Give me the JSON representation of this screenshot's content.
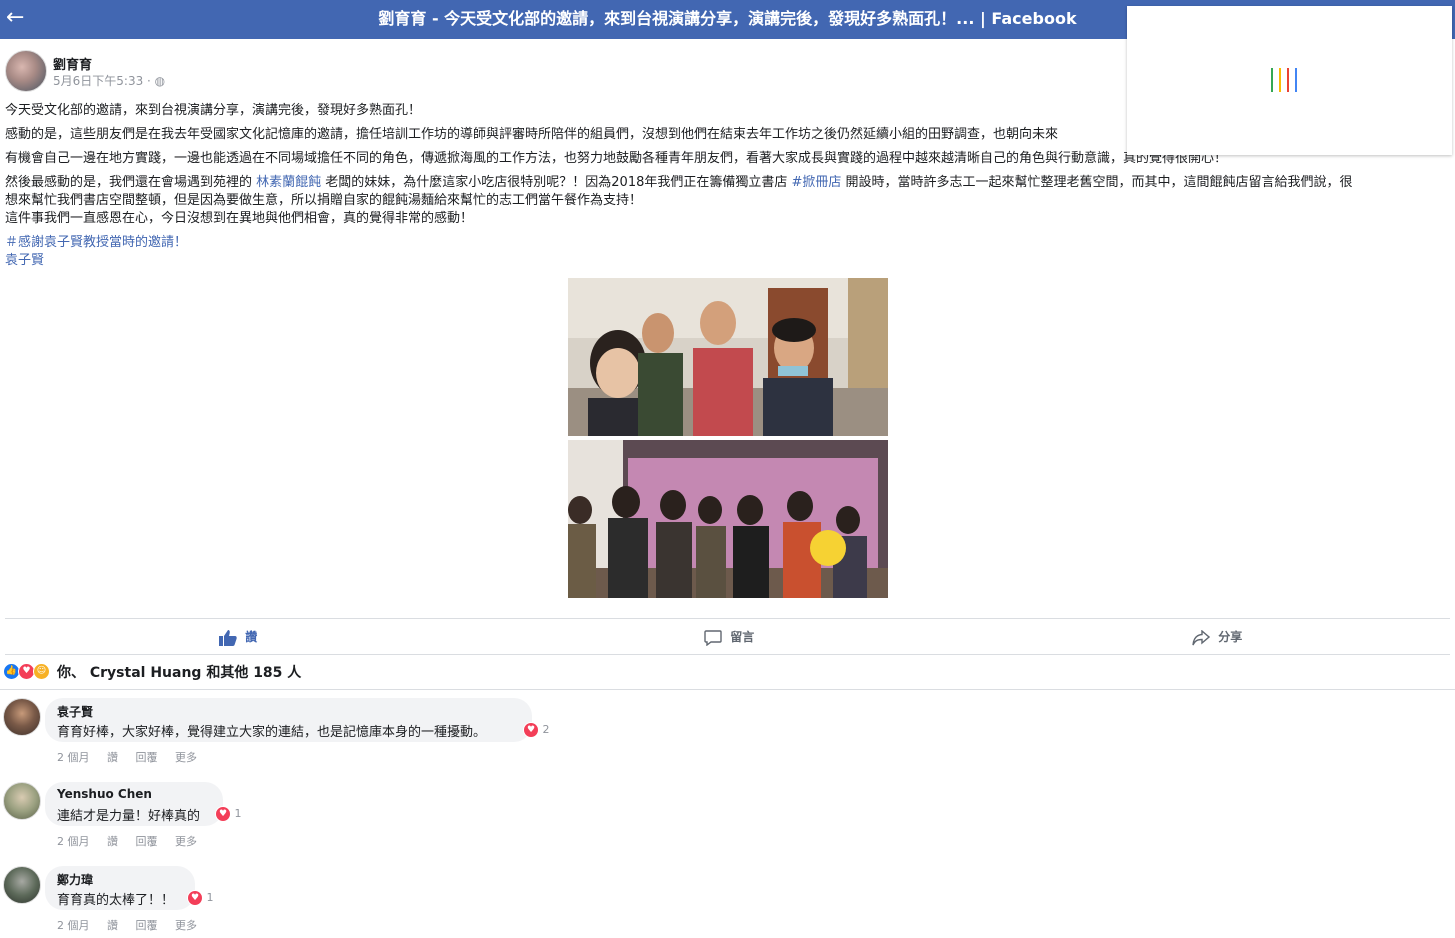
{
  "header": {
    "title": "劉育育 - 今天受文化部的邀請，來到台視演講分享，演講完後，發現好多熟面孔！... | Facebook",
    "back_icon": "←"
  },
  "loader": {
    "colors": [
      "#34a853",
      "#fbbc05",
      "#ea4335",
      "#4285f4"
    ]
  },
  "post": {
    "author": "劉育育",
    "meta": "5月6日下午5:33 · ◍",
    "lines": {
      "l1": "今天受文化部的邀請，來到台視演講分享，演講完後，發現好多熟面孔！",
      "l2": "感動的是，這些朋友們是在我去年受國家文化記憶庫的邀請，擔任培訓工作坊的導師與評審時所陪伴的組員們，沒想到他們在結束去年工作坊之後仍然延續小組的田野調查，也朝向未來",
      "l3": "有機會自己一邊在地方實踐，一邊也能透過在不同場域擔任不同的角色，傳遞掀海風的工作方法，也努力地鼓勵各種青年朋友們，看著大家成長與實踐的過程中越來越清晰自己的角色與行動意識，真的覺得很開心！",
      "l4a": "然後最感動的是，我們還在會場遇到苑裡的 ",
      "l4_link": "林素蘭餛飩",
      "l4b": " 老闆的妹妹，為什麼這家小吃店很特別呢？！因為2018年我們正在籌備獨立書店 ",
      "l4_tag": "#掀冊店",
      "l4c": " 開設時，當時許多志工一起來幫忙整理老舊空間，而其中，這間餛飩店留言給我們說，很",
      "l5": "想來幫忙我們書店空間整頓，但是因為要做生意，所以捐贈自家的餛飩湯麵給來幫忙的志工們當午餐作為支持！",
      "l6": "這件事我們一直感恩在心，今日沒想到在異地與他們相會，真的覺得非常的感動！",
      "hashtag": "＃感謝袁子賢教授當時的邀請！",
      "mention": "袁子賢"
    }
  },
  "actions": {
    "like": "讚",
    "comment": "留言",
    "share": "分享"
  },
  "reactions": {
    "text": "你、 Crystal Huang 和其他 185 人"
  },
  "comments": [
    {
      "name": "袁子賢",
      "text": "育育好棒，大家好棒，覺得建立大家的連結，也是記憶庫本身的一種擾動。",
      "reacts": "2",
      "time": "2 個月",
      "like": "讚",
      "reply": "回覆",
      "more": "更多"
    },
    {
      "name": "Yenshuo Chen",
      "text": "連結才是力量！好棒真的",
      "reacts": "1",
      "time": "2 個月",
      "like": "讚",
      "reply": "回覆",
      "more": "更多"
    },
    {
      "name": "鄭力瑋",
      "text": "育育真的太棒了！！",
      "reacts": "1",
      "time": "2 個月",
      "like": "讚",
      "reply": "回覆",
      "more": "更多"
    }
  ]
}
